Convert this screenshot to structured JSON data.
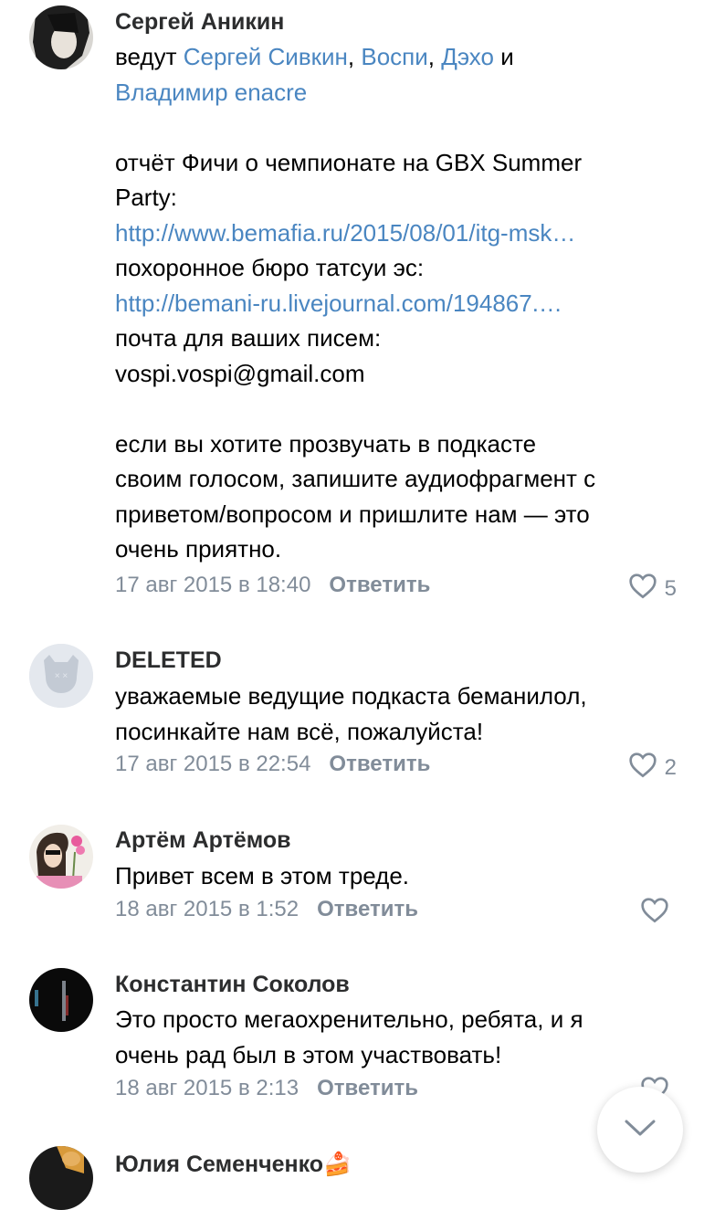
{
  "comments": [
    {
      "author": "Сергей Аникин",
      "intro": "ведут ",
      "hosts": [
        "Сергей Сивкин",
        "Воспи",
        "Дэхо",
        "Владимир enacre"
      ],
      "sep1": ", ",
      "sep2": " и",
      "p1": "отчёт Фичи о чемпионате на GBX Summer",
      "p2": "Party:",
      "link1": "http://www.bemafia.ru/2015/08/01/itg-msk…",
      "p3": "похоронное бюро татсуи эс:",
      "link2": "http://bemani-ru.livejournal.com/194867.…",
      "p4": "почта для ваших писем:",
      "p5": "vospi.vospi@gmail.com",
      "p6": "если вы хотите прозвучать в подкасте",
      "p7": "своим голосом, запишите аудиофрагмент с",
      "p8": "приветом/вопросом и пришлите нам — это",
      "p9": "очень приятно.",
      "date": "17 авг 2015 в 18:40",
      "reply": "Ответить",
      "likes": "5"
    },
    {
      "author": "DELETED",
      "lines": [
        "уважаемые ведущие подкаста беманилол,",
        "посинкайте нам всё, пожалуйста!"
      ],
      "date": "17 авг 2015 в 22:54",
      "reply": "Ответить",
      "likes": "2"
    },
    {
      "author": "Артём Артёмов",
      "lines": [
        "Привет всем в этом треде."
      ],
      "date": "18 авг 2015 в 1:52",
      "reply": "Ответить",
      "likes": ""
    },
    {
      "author": "Константин Соколов",
      "lines": [
        "Это просто мегаохренительно, ребята, и я",
        "очень рад был в этом участвовать!"
      ],
      "date": "18 авг 2015 в 2:13",
      "reply": "Ответить",
      "likes": ""
    },
    {
      "author": "Юлия Семенченко",
      "emoji": "🍰"
    }
  ],
  "icons": {
    "like": "heart-outline-icon",
    "scroll": "chevron-down-icon"
  },
  "colors": {
    "link": "#4a86c1",
    "meta": "#818c99"
  }
}
